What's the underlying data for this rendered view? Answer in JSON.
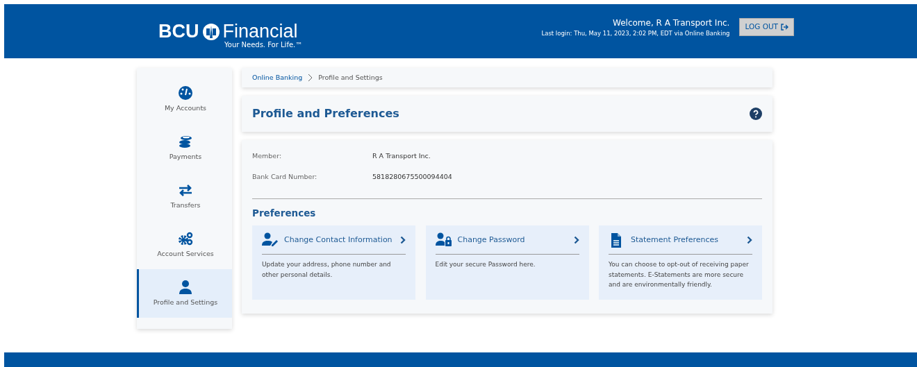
{
  "header": {
    "logo": {
      "brand": "BCU",
      "name": "Financial",
      "tagline": "Your Needs. For Life.™"
    },
    "welcome": "Welcome, R A Transport Inc.",
    "last_login": "Last login: Thu, May 11, 2023, 2:02 PM, EDT via Online Banking",
    "logout_button": "LOG OUT"
  },
  "sidebar": {
    "items": [
      {
        "kind": "accounts",
        "label": "My Accounts",
        "selected": false
      },
      {
        "kind": "payments",
        "label": "Payments",
        "selected": false
      },
      {
        "kind": "transfers",
        "label": "Transfers",
        "selected": false
      },
      {
        "kind": "services",
        "label": "Account Services",
        "selected": false
      },
      {
        "kind": "profile",
        "label": "Profile and Settings",
        "selected": true
      }
    ]
  },
  "breadcrumb": [
    "Online Banking",
    "Profile and Settings"
  ],
  "page_title": "Profile and Preferences",
  "details": [
    {
      "label": "Member:",
      "value": "R A Transport Inc."
    },
    {
      "label": "Bank Card Number:",
      "value": "5818280675500094404"
    }
  ],
  "preferences": {
    "title": "Preferences",
    "cards": [
      {
        "kind": "contact",
        "title": "Change Contact Information",
        "text": "Update your address, phone number and other personal details."
      },
      {
        "kind": "password",
        "title": "Change Password",
        "text": "Edit your secure Password here."
      },
      {
        "kind": "statement",
        "title": "Statement Preferences",
        "text": "You can choose to opt-out of receiving paper statements. E-Statements are more secure and are environmentally friendly."
      }
    ]
  }
}
